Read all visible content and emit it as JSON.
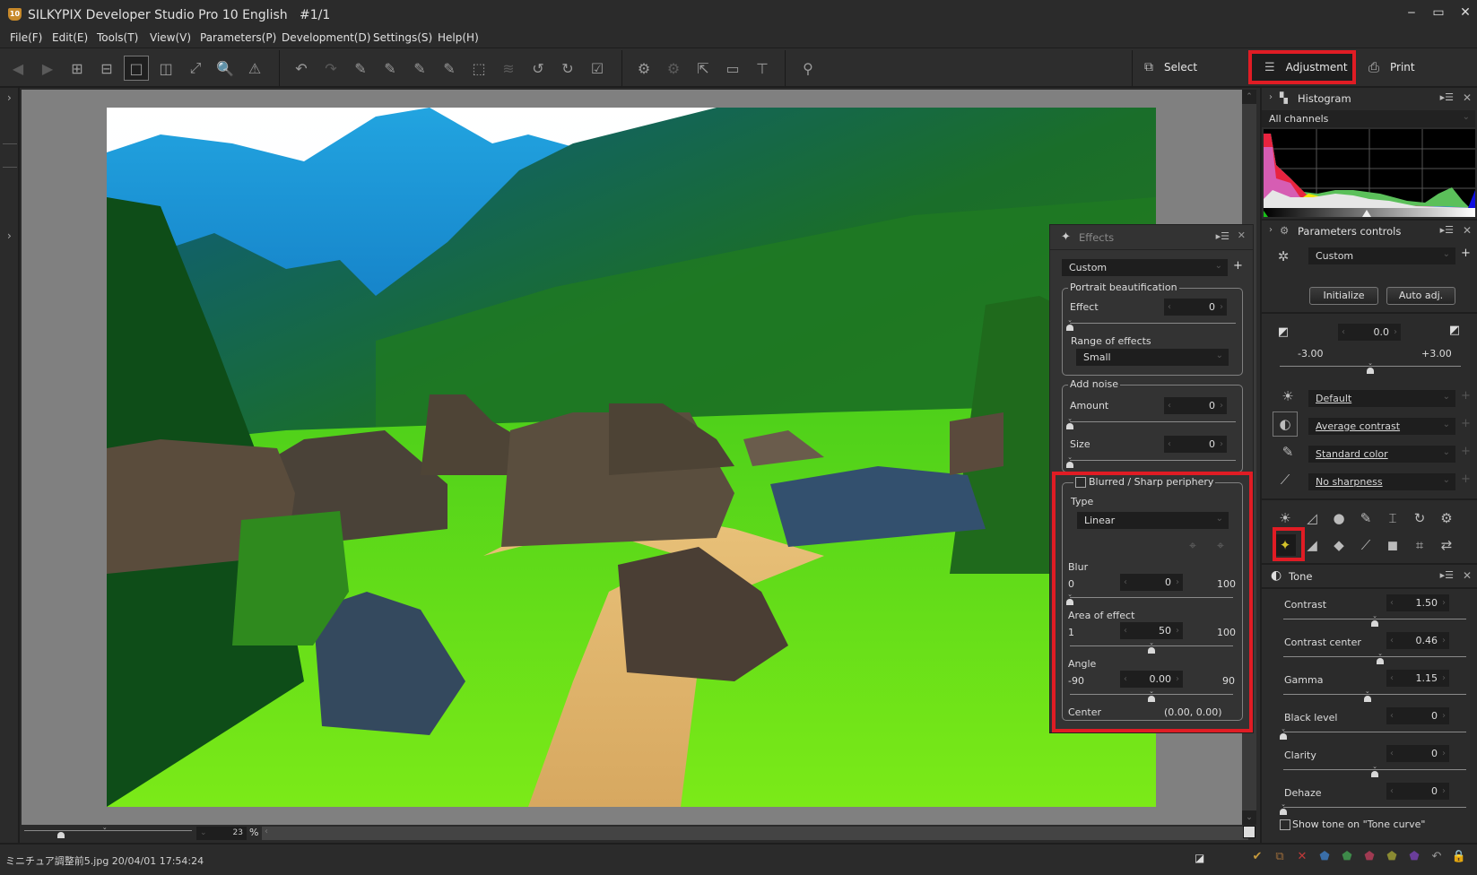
{
  "window": {
    "app_icon_label": "10",
    "title": "SILKYPIX Developer Studio Pro 10 English   #1/1",
    "minimize": "‒",
    "maximize": "▭",
    "close": "✕"
  },
  "menu": [
    "File(F)",
    "Edit(E)",
    "Tools(T)",
    "View(V)",
    "Parameters(P)",
    "Development(D)",
    "Settings(S)",
    "Help(H)"
  ],
  "toolbar": {
    "view_tools": [
      {
        "icon": "previous-image-icon",
        "glyph": "◀"
      },
      {
        "icon": "next-image-icon",
        "glyph": "▶"
      },
      {
        "icon": "thumbnail-grid-icon",
        "glyph": "⊞"
      },
      {
        "icon": "preview-thumbnails-icon",
        "glyph": "⊟"
      },
      {
        "icon": "single-preview-icon",
        "glyph": "□"
      },
      {
        "icon": "compare-view-icon",
        "glyph": "◫"
      },
      {
        "icon": "fullscreen-icon",
        "glyph": "⤢"
      },
      {
        "icon": "zoom-icon",
        "glyph": "🔍"
      },
      {
        "icon": "warning-icon",
        "glyph": "⚠"
      }
    ],
    "edit_tools": [
      {
        "icon": "undo-icon",
        "glyph": "↶"
      },
      {
        "icon": "redo-icon",
        "glyph": "↷"
      },
      {
        "icon": "exposure-picker-icon",
        "glyph": "✎"
      },
      {
        "icon": "gray-balance-picker-icon",
        "glyph": "✎"
      },
      {
        "icon": "tone-picker-icon",
        "glyph": "✎"
      },
      {
        "icon": "film-picker-icon",
        "glyph": "✎"
      },
      {
        "icon": "transform-icon",
        "glyph": "⬚"
      },
      {
        "icon": "layers-icon",
        "glyph": "≋"
      },
      {
        "icon": "rotate-left-icon",
        "glyph": "↺"
      },
      {
        "icon": "rotate-right-icon",
        "glyph": "↻"
      },
      {
        "icon": "mark-check-icon",
        "glyph": "☑"
      }
    ],
    "dev_tools": [
      {
        "icon": "develop-save-icon",
        "glyph": "⚙"
      },
      {
        "icon": "develop-check-icon",
        "glyph": "⚙"
      },
      {
        "icon": "export-icon",
        "glyph": "⇱"
      },
      {
        "icon": "monitor-icon",
        "glyph": "▭"
      },
      {
        "icon": "hammer-icon",
        "glyph": "⊤"
      }
    ],
    "search_tool": {
      "icon": "search-settings-icon",
      "glyph": "⚲"
    },
    "modes": {
      "select": "Select",
      "adjustment": "Adjustment",
      "print": "Print"
    }
  },
  "canvas": {
    "zoom_value": "23",
    "zoom_unit": "%"
  },
  "status": {
    "file_info": "ミニチュア調整前5.jpg 20/04/01 17:54:24",
    "mark_icons": [
      "check-mark-icon",
      "copy-icon",
      "reject-icon",
      "blue-tag-icon",
      "green-tag-icon",
      "red-tag-icon",
      "yellow-tag-icon",
      "purple-tag-icon",
      "revert-icon",
      "lock-icon"
    ],
    "mark_colors": [
      "#c79a3c",
      "#9a6b3a",
      "#c03a3a",
      "#3a6ea8",
      "#3e8a4a",
      "#a03a52",
      "#8a8a32",
      "#6a3e9a",
      "#999999",
      "#8a7a5a"
    ]
  },
  "effects_panel": {
    "title": "Effects",
    "preset": "Custom",
    "portrait": {
      "legend": "Portrait beautification",
      "effect_label": "Effect",
      "effect_value": "0",
      "effect_fraction": 0,
      "range_label": "Range of effects",
      "range_value": "Small"
    },
    "noise": {
      "legend": "Add noise",
      "amount_label": "Amount",
      "amount_value": "0",
      "amount_fraction": 0,
      "size_label": "Size",
      "size_value": "0",
      "size_fraction": 0
    },
    "periphery": {
      "legend": "Blurred / Sharp periphery",
      "enabled": false,
      "type_label": "Type",
      "type_value": "Linear",
      "blur_label": "Blur",
      "blur_min": "0",
      "blur_max": "100",
      "blur_value": "0",
      "blur_fraction": 0,
      "area_label": "Area of effect",
      "area_min": "1",
      "area_max": "100",
      "area_value": "50",
      "area_fraction": 0.5,
      "angle_label": "Angle",
      "angle_min": "-90",
      "angle_max": "90",
      "angle_value": "0.00",
      "angle_fraction": 0.5,
      "center_label": "Center",
      "center_value": "(0.00, 0.00)"
    },
    "highlight_color": "#e01c24"
  },
  "right_panel": {
    "histogram": {
      "title": "Histogram",
      "channel": "All channels"
    },
    "params": {
      "title": "Parameters controls",
      "preset": "Custom",
      "initialize": "Initialize",
      "auto_adj": "Auto adj.",
      "exposure_value": "0.0",
      "exposure_min": "-3.00",
      "exposure_max": "+3.00",
      "exposure_fraction": 0.5,
      "white_balance": "Default",
      "tone": "Average contrast",
      "color": "Standard color",
      "sharpness": "No sharpness"
    },
    "tools_row1": [
      "exposure-tool-icon",
      "tone-curve-icon",
      "color-balance-icon",
      "color-picker-tool-icon",
      "noise-reduction-icon",
      "rotation-icon",
      "advanced-settings-icon"
    ],
    "tools_row2": [
      "effects-icon",
      "gradient-icon",
      "fisheye-icon",
      "brush-icon",
      "shading-icon",
      "crop-icon",
      "conversion-icon"
    ],
    "tone": {
      "title": "Tone",
      "rows": [
        {
          "label": "Contrast",
          "value": "1.50",
          "fraction": 0.5
        },
        {
          "label": "Contrast center",
          "value": "0.46",
          "fraction": 0.53
        },
        {
          "label": "Gamma",
          "value": "1.15",
          "fraction": 0.46
        },
        {
          "label": "Black level",
          "value": "0",
          "fraction": 0
        },
        {
          "label": "Clarity",
          "value": "0",
          "fraction": 0.5
        },
        {
          "label": "Dehaze",
          "value": "0",
          "fraction": 0
        }
      ],
      "show_on_curve": "Show tone on \"Tone curve\""
    }
  }
}
